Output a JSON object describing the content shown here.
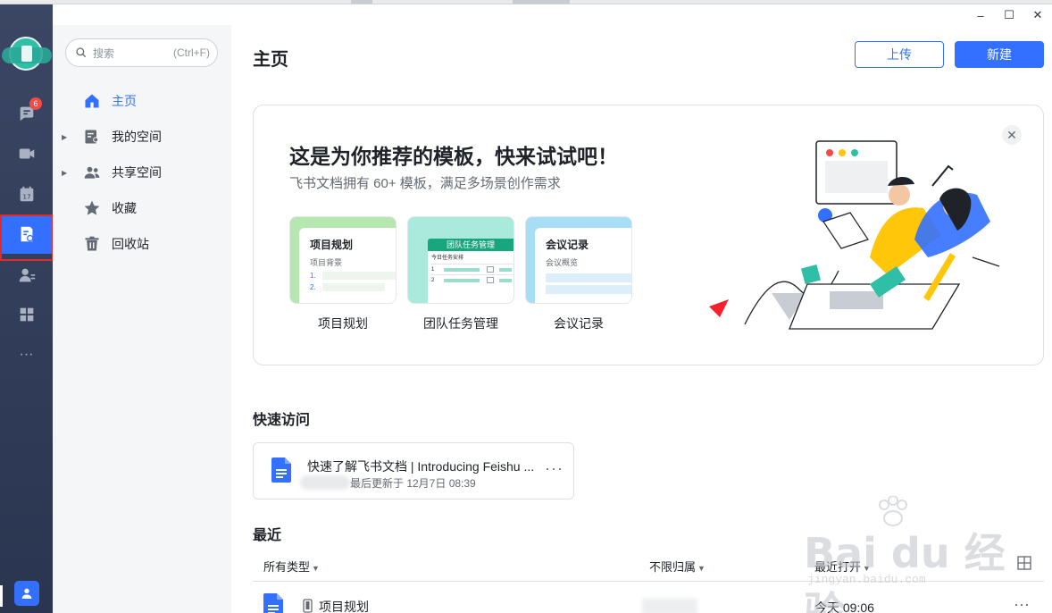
{
  "window": {
    "minimize": "–",
    "maximize": "☐",
    "close": "✕"
  },
  "rail": {
    "badge_count": "6",
    "items": [
      "chat",
      "video",
      "calendar",
      "docs",
      "contacts",
      "workplace",
      "more"
    ],
    "more_label": "···"
  },
  "sidebar": {
    "search_placeholder": "搜索",
    "search_shortcut": "(Ctrl+F)",
    "items": [
      {
        "label": "主页",
        "icon": "home-icon",
        "active": true
      },
      {
        "label": "我的空间",
        "icon": "my-space-icon"
      },
      {
        "label": "共享空间",
        "icon": "shared-space-icon"
      },
      {
        "label": "收藏",
        "icon": "star-icon"
      },
      {
        "label": "回收站",
        "icon": "trash-icon"
      }
    ]
  },
  "main": {
    "title": "主页",
    "upload_label": "上传",
    "new_label": "新建",
    "banner": {
      "title": "这是为你推荐的模板，快来试试吧！",
      "subtitle": "飞书文档拥有 60+ 模板，满足多场景创作需求",
      "close": "✕",
      "templates": [
        {
          "name": "项目规划",
          "card_title": "项目规划",
          "card_sub": "项目背景",
          "items": [
            "1.",
            "2."
          ],
          "color": "#b6e7b0"
        },
        {
          "name": "团队任务管理",
          "card_title": "团队任务管理",
          "card_sub": "今日任务安排",
          "rows": [
            "1",
            "2"
          ],
          "color": "#a9eadc"
        },
        {
          "name": "会议记录",
          "card_title": "会议记录",
          "card_sub": "会议概览",
          "color": "#a8def5"
        }
      ]
    },
    "quick_access": {
      "title": "快速访问",
      "item": {
        "title": "快速了解飞书文档 | Introducing Feishu ...",
        "meta": "最后更新于 12月7日 08:39",
        "meta_prefix": "",
        "more": "···"
      }
    },
    "recent": {
      "title": "最近",
      "col_type": "所有类型",
      "col_owner": "不限归属",
      "col_opened": "最近打开",
      "arrow": "▼",
      "rows": [
        {
          "name": "项目规划",
          "opened": "今天 09:06",
          "more": "···"
        }
      ]
    }
  },
  "watermark": {
    "brand": "Bai du 经验",
    "url": "jingyan.baidu.com"
  },
  "colors": {
    "accent": "#3370ff",
    "rail": "#34405c",
    "badge": "#f54a45",
    "highlight_border": "#e02b2b"
  }
}
